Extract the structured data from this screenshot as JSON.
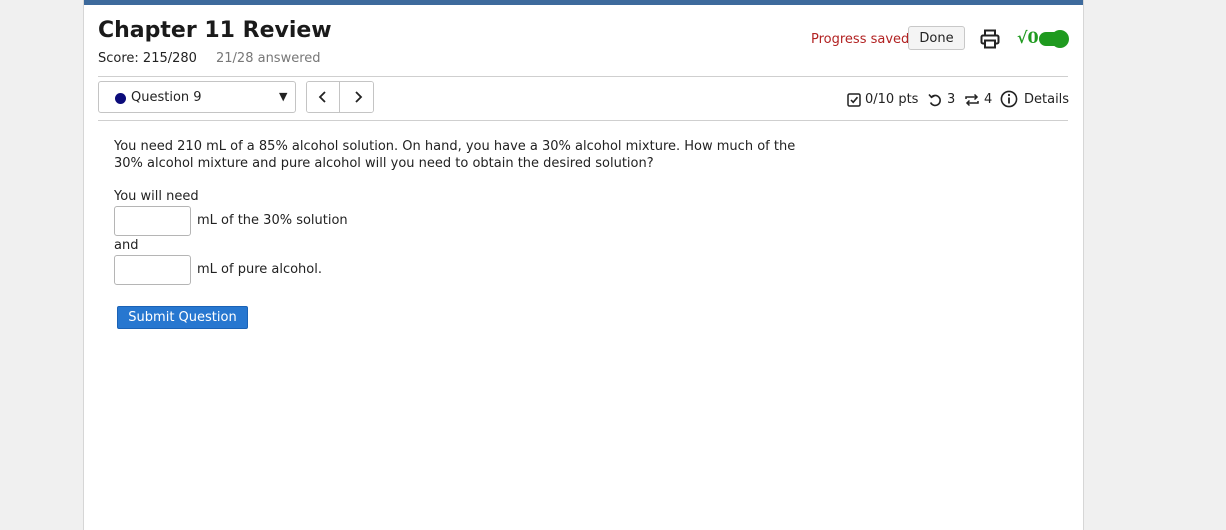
{
  "colors": {
    "top_bar": "#3d6a9c",
    "progress_saved": "#b22222",
    "question_dot": "#0b0b7a",
    "toggle_green": "#1f9a1f",
    "submit_blue": "#2777d0",
    "page_background": "#f0f0f0"
  },
  "header": {
    "title": "Chapter 11 Review",
    "score": "Score: 215/280",
    "answered": "21/28 answered",
    "progress_saved": "Progress saved",
    "done_label": "Done",
    "print_icon": "printer-icon",
    "math_toggle_label": "√0",
    "math_toggle_on": true
  },
  "question_nav": {
    "selected_question": "Question 9",
    "prev_icon": "chevron-left-icon",
    "next_icon": "chevron-right-icon",
    "points": "0/10 pts",
    "retries": "3",
    "attempts": "4",
    "details": "Details"
  },
  "question": {
    "text": "You need 210 mL of a 85% alcohol solution. On hand, you have a 30% alcohol mixture. How much of the 30% alcohol mixture and pure alcohol will you need to obtain the desired solution?",
    "intro": "You will need",
    "answer1_label": "mL of the 30% solution",
    "answer1_value": "",
    "connector": "and",
    "answer2_label": "mL of pure alcohol.",
    "answer2_value": "",
    "submit_label": "Submit Question"
  }
}
